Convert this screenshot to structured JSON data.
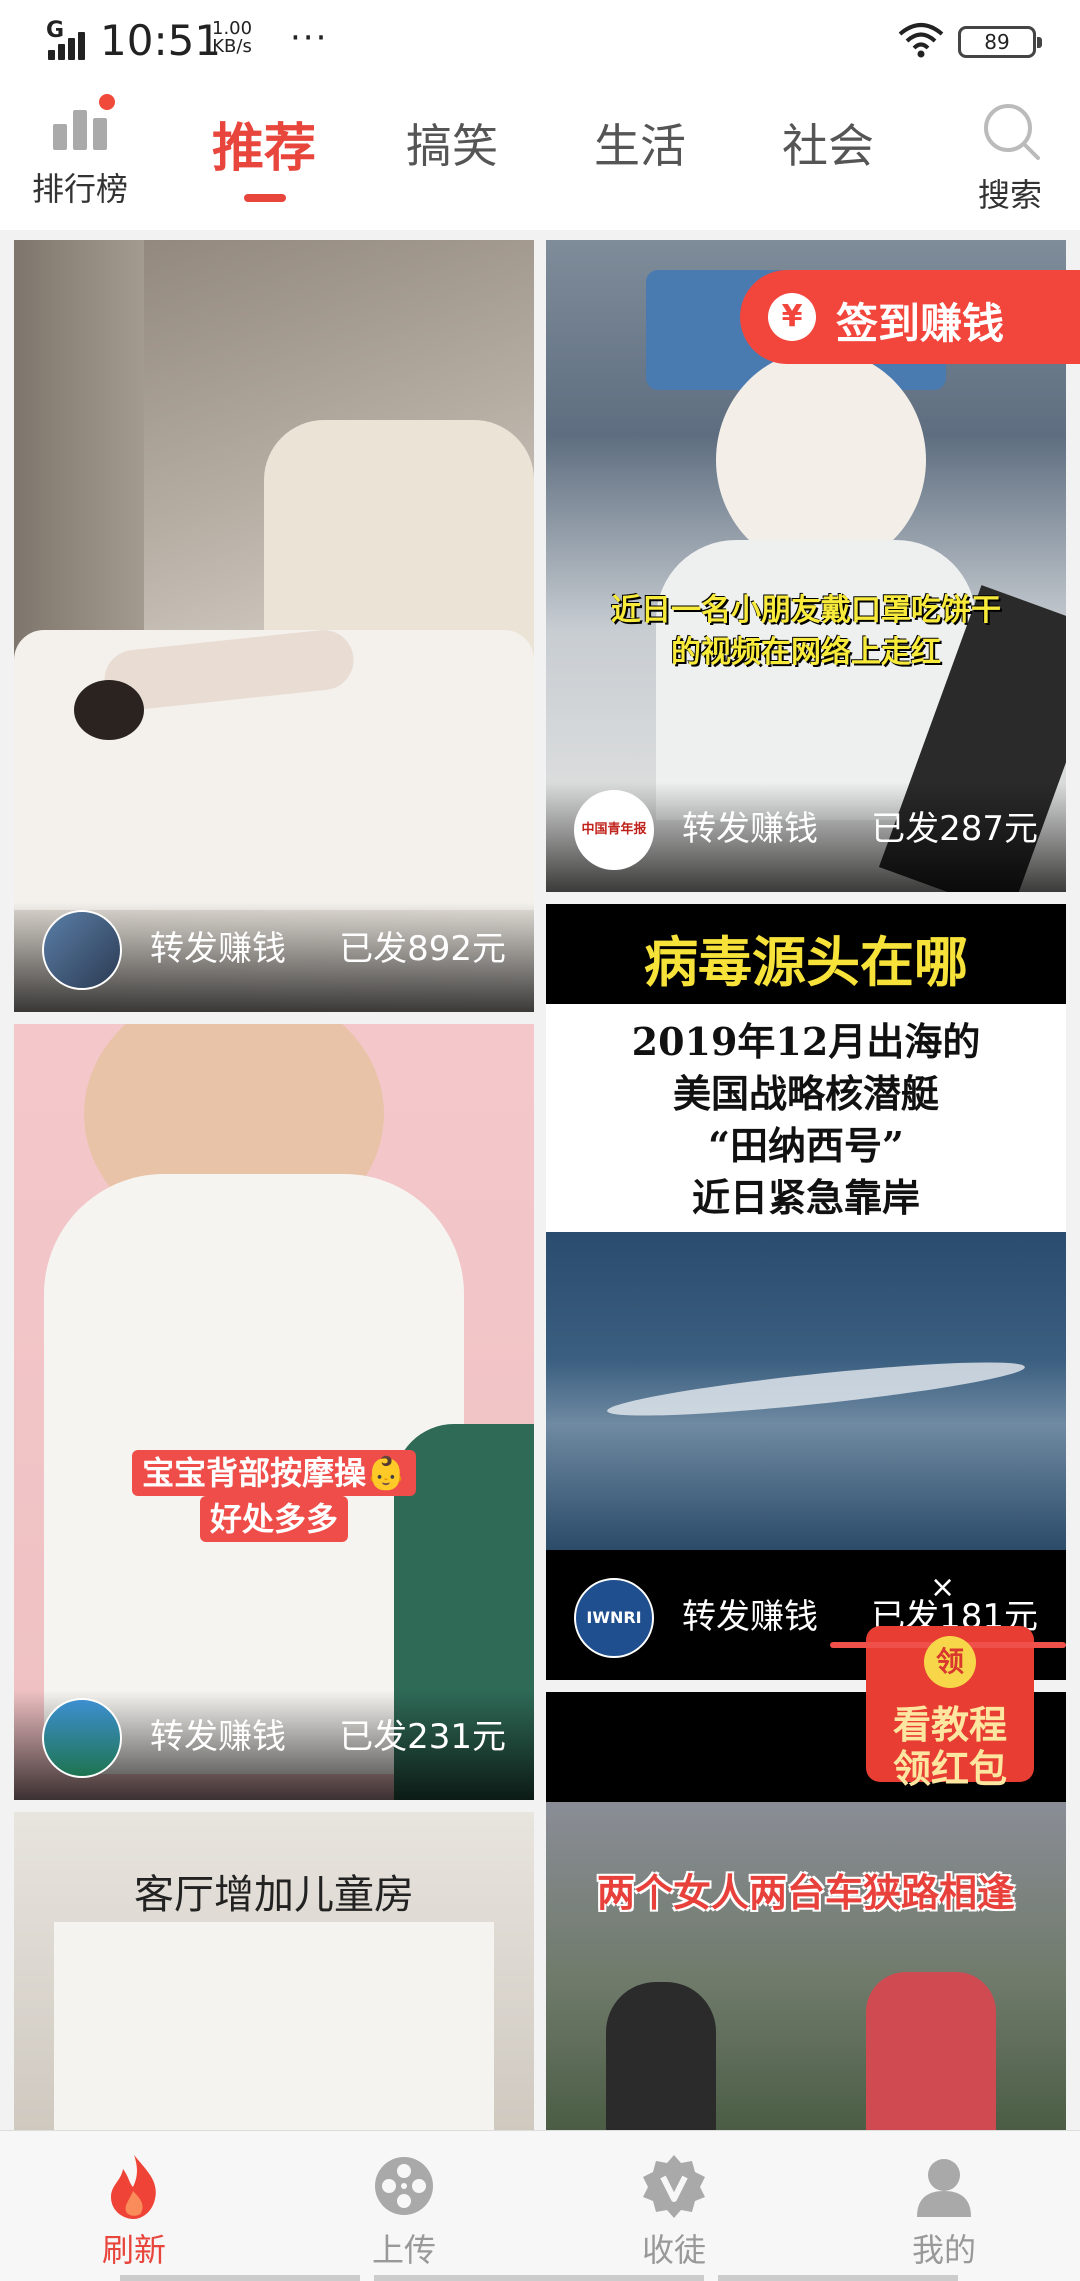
{
  "status_bar": {
    "network": "G",
    "time": "10:51",
    "speed_value": "1.00",
    "speed_unit": "KB/s",
    "dots": "···",
    "battery": "89"
  },
  "top_nav": {
    "ranking_label": "排行榜",
    "tabs": [
      {
        "label": "推荐",
        "active": true
      },
      {
        "label": "搞笑",
        "active": false
      },
      {
        "label": "生活",
        "active": false
      },
      {
        "label": "社会",
        "active": false
      }
    ],
    "search_label": "搜索",
    "accent": "#e8453c"
  },
  "cards": {
    "left_1": {
      "share_label": "转发赚钱",
      "earned": "已发892元"
    },
    "right_1": {
      "overlay": "近日一名小朋友戴口罩吃饼干\n的视频在网络上走红",
      "source_logo_text": "中国青年报",
      "share_label": "转发赚钱",
      "earned": "已发287元"
    },
    "left_2": {
      "overlay": "宝宝背部按摩操👶\n好处多多",
      "share_label": "转发赚钱",
      "earned": "已发231元"
    },
    "right_2": {
      "headline": "病毒源头在哪",
      "subline": "2019年12月出海的\n美国战略核潜艇\n“田纳西号”\n近日紧急靠岸",
      "avatar_text": "IWNRI",
      "share_label": "转发赚钱",
      "earned": "已发181元"
    },
    "left_3": {
      "overlay": "客厅增加儿童房"
    },
    "right_3": {
      "overlay": "两个女人两台车狭路相逢"
    }
  },
  "signin_badge": {
    "icon": "¥",
    "label": "签到赚钱"
  },
  "red_packet": {
    "close": "×",
    "coin": "领",
    "line1": "看教程",
    "line2": "领红包"
  },
  "bottom_nav": [
    {
      "label": "刷新",
      "icon": "flame-icon",
      "active": true
    },
    {
      "label": "上传",
      "icon": "film-reel-icon",
      "active": false
    },
    {
      "label": "收徒",
      "icon": "v-badge-icon",
      "active": false
    },
    {
      "label": "我的",
      "icon": "user-icon",
      "active": false
    }
  ]
}
